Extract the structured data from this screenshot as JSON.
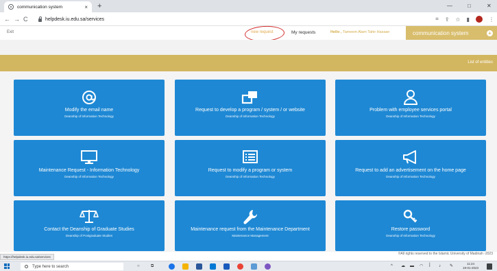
{
  "browser": {
    "tab_title": "communication system",
    "tab_close": "×",
    "new_tab": "+",
    "back": "←",
    "forward": "→",
    "reload": "C",
    "url": "helpdesk.iu.edu.sa/services",
    "minimize": "—",
    "restore": "□",
    "close": "✕"
  },
  "header": {
    "exit": "Exit",
    "new_request": "new request",
    "my_requests": "My requests",
    "hello_prefix": "Hello ,",
    "user_name": "Tameem Alam Tahir Hassan",
    "brand": "communication system",
    "brand_plus": "+"
  },
  "banner": {
    "list_of_entities": "List of entities"
  },
  "cards": [
    {
      "title": "Modify the email name",
      "subtitle": "Deanship of Information Technology",
      "icon": "at-icon"
    },
    {
      "title": "Request to develop a program / system / or website",
      "subtitle": "Deanship of Information Technology",
      "icon": "windows-stack-icon"
    },
    {
      "title": "Problem with employee services portal",
      "subtitle": "Deanship of Information Technology",
      "icon": "user-icon"
    },
    {
      "title": "Maintenance Request - Information Technology",
      "subtitle": "Deanship of Information Technology",
      "icon": "monitor-icon"
    },
    {
      "title": "Request to modify a program or system",
      "subtitle": "Deanship of Information Technology",
      "icon": "list-window-icon"
    },
    {
      "title": "Request to add an advertisement on the home page",
      "subtitle": "Deanship of Information Technology",
      "icon": "megaphone-icon"
    },
    {
      "title": "Contact the Deanship of Graduate Studies",
      "subtitle": "Deanship of Postgraduate Studies",
      "icon": "scales-icon"
    },
    {
      "title": "Maintenance request from the Maintenance Department",
      "subtitle": "Maintenance Management",
      "icon": "wrench-icon"
    },
    {
      "title": "Restore password",
      "subtitle": "Deanship of Information Technology",
      "icon": "key-icon"
    }
  ],
  "footer": {
    "copyright": "©All rights reserved to the Islamic University of Madinah -2023",
    "status_url": "https://helpdesk.iu.edu.sa/services"
  },
  "taskbar": {
    "search_placeholder": "Type here to search",
    "time": "11:24",
    "date": "19-01-2023"
  },
  "colors": {
    "card_blue": "#1e88d4",
    "gold": "#d3b660",
    "brand_gold": "#d8bd6c",
    "annotation_red": "#d32f2f"
  }
}
